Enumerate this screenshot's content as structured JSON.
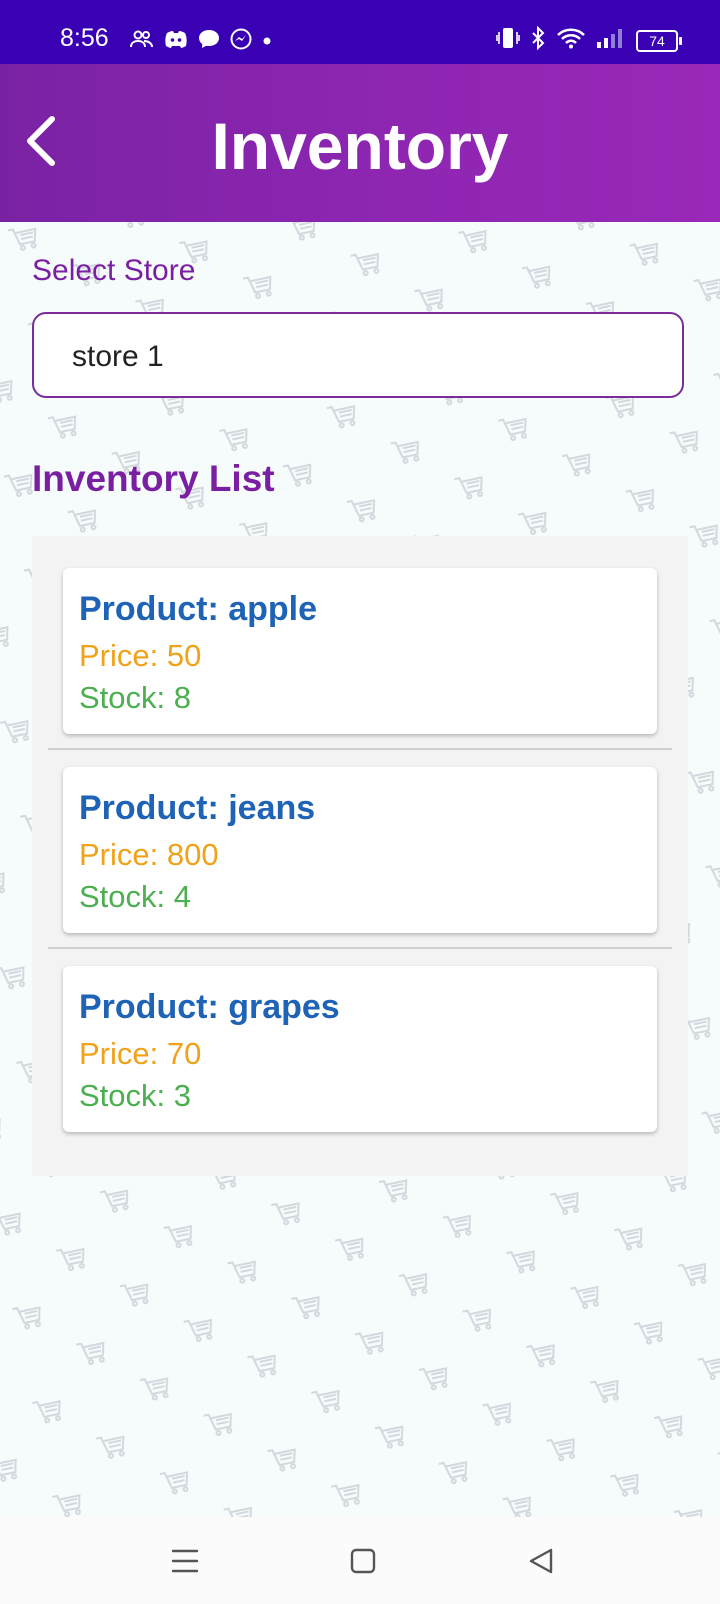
{
  "status": {
    "time": "8:56",
    "battery": "74"
  },
  "appbar": {
    "title": "Inventory"
  },
  "form": {
    "label": "Select Store",
    "selected": "store 1"
  },
  "list": {
    "title": "Inventory List",
    "items": [
      {
        "product": "Product: apple",
        "price": "Price: 50",
        "stock": "Stock: 8"
      },
      {
        "product": "Product: jeans",
        "price": "Price: 800",
        "stock": "Stock: 4"
      },
      {
        "product": "Product: grapes",
        "price": "Price: 70",
        "stock": "Stock: 3"
      }
    ]
  },
  "colors": {
    "statusbar": "#3a00b4",
    "appbar": "#8e26b2",
    "accent": "#7b1fa2",
    "product": "#1e63b5",
    "price": "#f0a21a",
    "stock": "#4caf50"
  },
  "icons": [
    "people-icon",
    "discord-icon",
    "chat-bubble-icon",
    "messenger-icon",
    "dot-icon",
    "vibrate-icon",
    "bluetooth-icon",
    "wifi-icon",
    "signal-icon",
    "battery-icon",
    "back-arrow-icon",
    "shopping-cart-icon",
    "menu-icon",
    "home-square-icon",
    "back-triangle-icon"
  ]
}
